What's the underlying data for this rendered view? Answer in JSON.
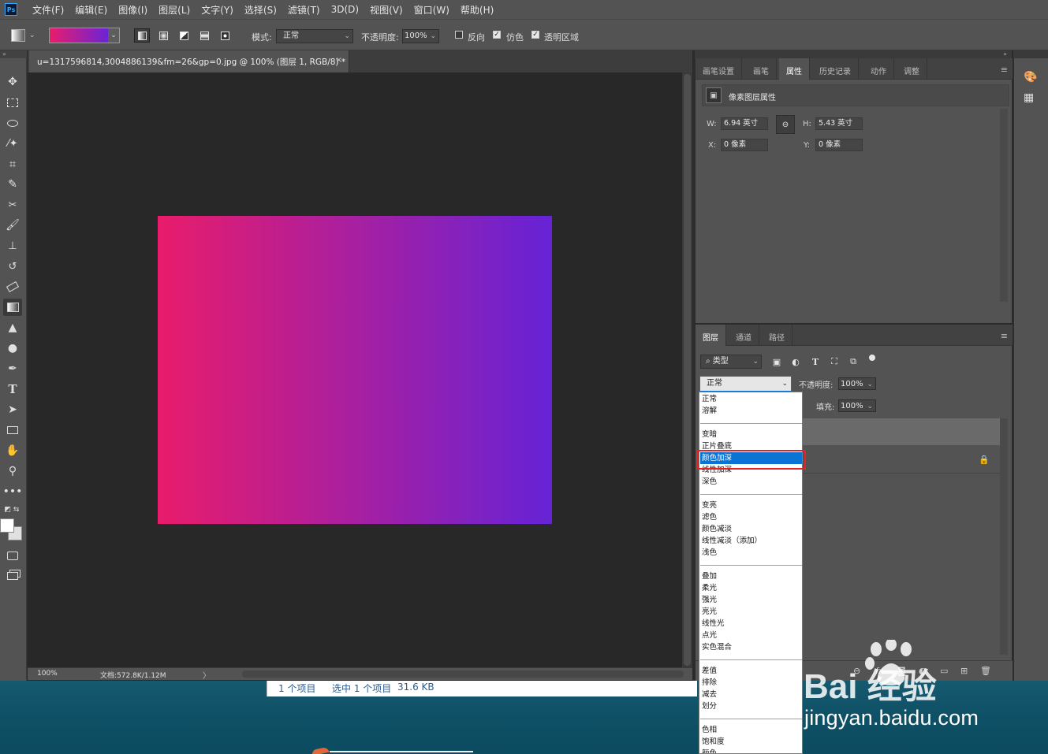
{
  "app": {
    "logo": "Ps"
  },
  "menu": [
    "文件(F)",
    "编辑(E)",
    "图像(I)",
    "图层(L)",
    "文字(Y)",
    "选择(S)",
    "滤镜(T)",
    "3D(D)",
    "视图(V)",
    "窗口(W)",
    "帮助(H)"
  ],
  "options_bar": {
    "mode_label": "模式:",
    "mode_value": "正常",
    "opacity_label": "不透明度:",
    "opacity_value": "100%",
    "reverse_label": "反向",
    "dither_label": "仿色",
    "transparency_label": "透明区域",
    "reverse_checked": false,
    "dither_checked": true,
    "transparency_checked": true,
    "gradient_colors": [
      "#e91c6b",
      "#6b23d6"
    ]
  },
  "document": {
    "tab_title": "u=1317596814,3004886139&fm=26&gp=0.jpg @ 100% (图层 1, RGB/8) *",
    "close": "×",
    "canvas_gradient": [
      "#e91c6b",
      "#6623d6"
    ],
    "status_zoom": "100%",
    "status_doc": "文档:572.8K/1.12M",
    "status_arrow": "〉"
  },
  "tools": [
    "move-tool",
    "marquee-tool",
    "lasso-tool",
    "magic-wand-tool",
    "crop-tool",
    "eyedropper-tool",
    "healing-tool",
    "brush-tool",
    "stamp-tool",
    "history-brush-tool",
    "eraser-tool",
    "gradient-tool",
    "blur-tool",
    "dodge-tool",
    "pen-tool",
    "type-tool",
    "path-select-tool",
    "rectangle-tool",
    "hand-tool",
    "zoom-tool",
    "more-tools"
  ],
  "properties_panel": {
    "tabs": [
      "画笔设置",
      "画笔",
      "属性",
      "历史记录",
      "动作",
      "调整"
    ],
    "active_tab": "属性",
    "title": "像素图层属性",
    "w_label": "W:",
    "w_value": "6.94 英寸",
    "h_label": "H:",
    "h_value": "5.43 英寸",
    "x_label": "X:",
    "x_value": "0 像素",
    "y_label": "Y:",
    "y_value": "0 像素"
  },
  "layers_panel": {
    "tabs": [
      "图层",
      "通道",
      "路径"
    ],
    "active_tab": "图层",
    "filter_kind": "类型",
    "blend_mode": "正常",
    "opacity_label": "不透明度:",
    "opacity_value": "100%",
    "fill_label": "填充:",
    "fill_value": "100%"
  },
  "blend_modes": {
    "groups": [
      [
        "正常",
        "溶解"
      ],
      [
        "变暗",
        "正片叠底",
        "颜色加深",
        "线性加深",
        "深色"
      ],
      [
        "变亮",
        "滤色",
        "颜色减淡",
        "线性减淡（添加）",
        "浅色"
      ],
      [
        "叠加",
        "柔光",
        "强光",
        "亮光",
        "线性光",
        "点光",
        "实色混合"
      ],
      [
        "差值",
        "排除",
        "减去",
        "划分"
      ],
      [
        "色相",
        "饱和度",
        "颜色"
      ]
    ],
    "highlighted": "颜色加深"
  },
  "explorer_status": {
    "items": "1 个项目",
    "selected": "选中 1 个项目",
    "size": "31.6 KB"
  },
  "watermark": {
    "logo_text": "Bai  经验",
    "url": "jingyan.baidu.com"
  },
  "colors": {
    "highlight_box": "#e5231f",
    "selection_blue": "#0a74d4"
  }
}
